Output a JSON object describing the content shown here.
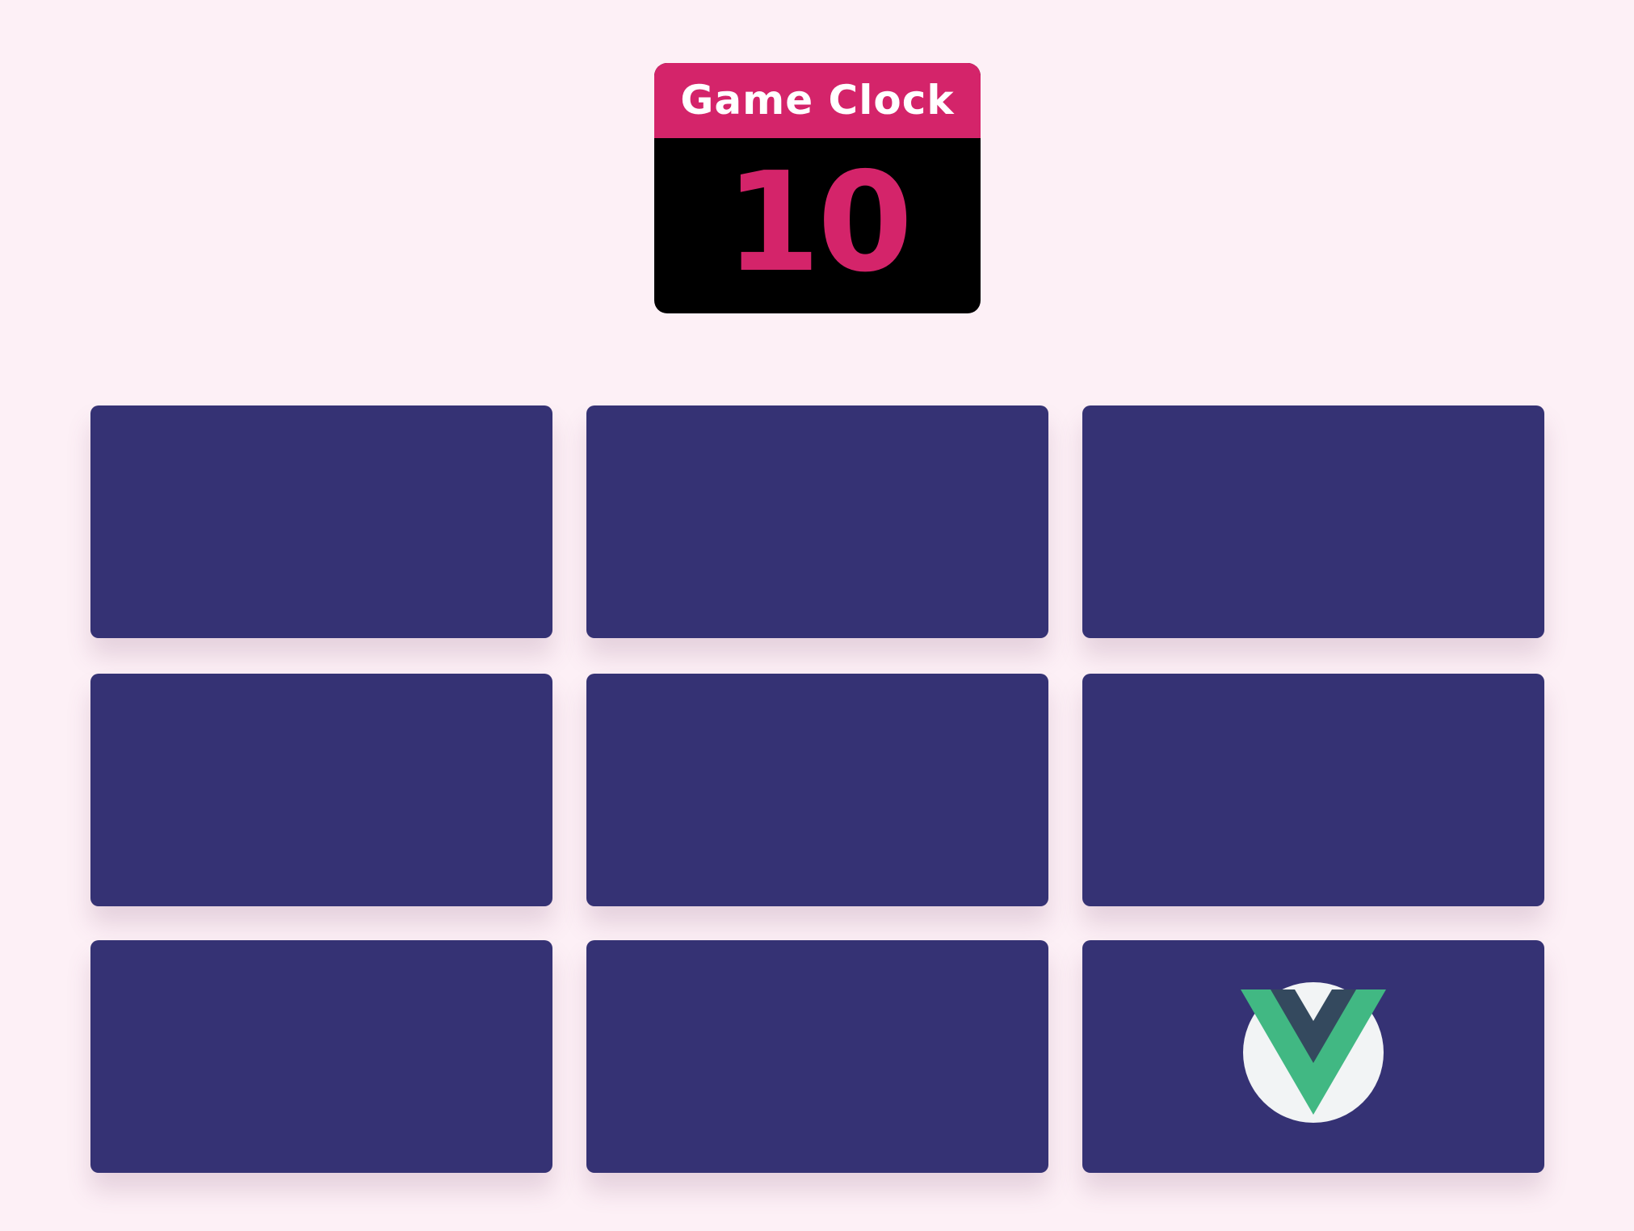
{
  "clock": {
    "title": "Game Clock",
    "value": "10"
  },
  "colors": {
    "background": "#fdf0f6",
    "accent": "#d4246a",
    "clock_body": "#000000",
    "card_back": "#353274",
    "vue_green": "#41b883",
    "vue_dark": "#34495e",
    "badge": "#f2f4f5"
  },
  "cards": [
    {
      "state": "face-down"
    },
    {
      "state": "face-down"
    },
    {
      "state": "face-down"
    },
    {
      "state": "face-down"
    },
    {
      "state": "face-down"
    },
    {
      "state": "face-down"
    },
    {
      "state": "face-down"
    },
    {
      "state": "face-down"
    },
    {
      "state": "face-up",
      "icon": "vue-logo-icon"
    }
  ]
}
